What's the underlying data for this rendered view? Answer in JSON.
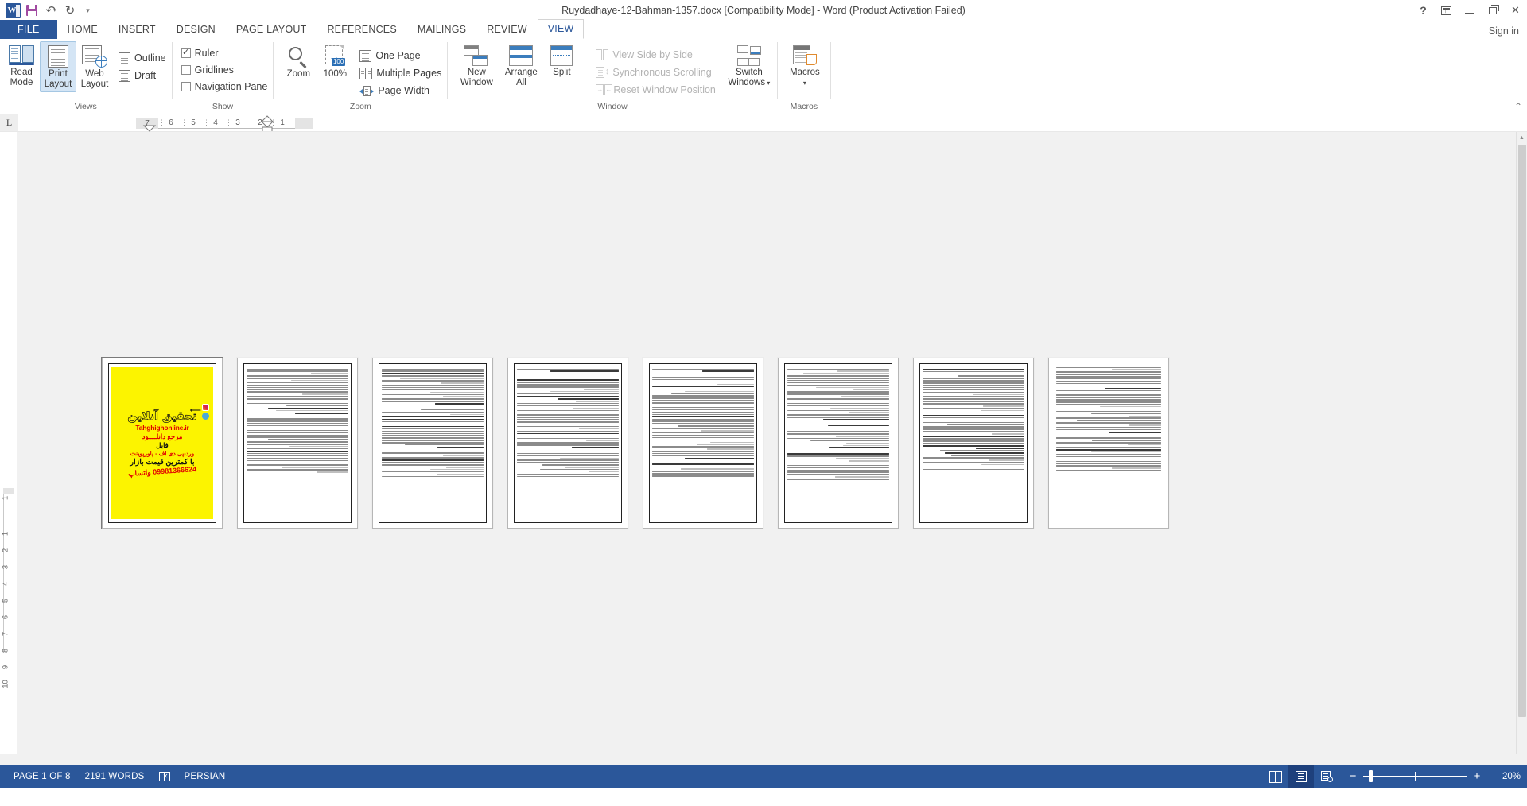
{
  "titlebar": {
    "document_title": "Ruydadhaye-12-Bahman-1357.docx [Compatibility Mode] - Word (Product Activation Failed)",
    "quick_access": [
      {
        "name": "word-logo",
        "label": "W"
      },
      {
        "name": "save-icon",
        "label": "Save"
      },
      {
        "name": "undo-icon",
        "label": "Undo"
      },
      {
        "name": "redo-icon",
        "label": "Redo"
      },
      {
        "name": "customize-qat-icon",
        "label": "Customize Quick Access Toolbar"
      }
    ],
    "window_controls": [
      {
        "name": "help",
        "label": "?"
      },
      {
        "name": "ribbon-display-options",
        "label": "Ribbon Display Options"
      },
      {
        "name": "minimize",
        "label": "Minimize"
      },
      {
        "name": "restore",
        "label": "Restore Down"
      },
      {
        "name": "close",
        "label": "✕"
      }
    ],
    "sign_in": "Sign in"
  },
  "tabs": [
    {
      "label": "FILE",
      "active": false,
      "file": true
    },
    {
      "label": "HOME",
      "active": false
    },
    {
      "label": "INSERT",
      "active": false
    },
    {
      "label": "DESIGN",
      "active": false
    },
    {
      "label": "PAGE LAYOUT",
      "active": false
    },
    {
      "label": "REFERENCES",
      "active": false
    },
    {
      "label": "MAILINGS",
      "active": false
    },
    {
      "label": "REVIEW",
      "active": false
    },
    {
      "label": "VIEW",
      "active": true
    }
  ],
  "ribbon": {
    "groups": [
      {
        "name": "views",
        "label": "Views",
        "buttons": [
          {
            "name": "read-mode",
            "line1": "Read",
            "line2": "Mode",
            "selected": false
          },
          {
            "name": "print-layout",
            "line1": "Print",
            "line2": "Layout",
            "selected": true
          },
          {
            "name": "web-layout",
            "line1": "Web",
            "line2": "Layout",
            "selected": false
          }
        ],
        "small_items": [
          {
            "name": "outline",
            "label": "Outline"
          },
          {
            "name": "draft",
            "label": "Draft"
          }
        ]
      },
      {
        "name": "show",
        "label": "Show",
        "checkboxes": [
          {
            "name": "ruler",
            "label": "Ruler",
            "checked": true
          },
          {
            "name": "gridlines",
            "label": "Gridlines",
            "checked": false
          },
          {
            "name": "navigation-pane",
            "label": "Navigation Pane",
            "checked": false
          }
        ]
      },
      {
        "name": "zoom",
        "label": "Zoom",
        "buttons": [
          {
            "name": "zoom",
            "line1": "Zoom",
            "line2": ""
          },
          {
            "name": "zoom-100",
            "line1": "100%",
            "line2": "",
            "badge": "100"
          }
        ],
        "small_items": [
          {
            "name": "one-page",
            "label": "One Page"
          },
          {
            "name": "multiple-pages",
            "label": "Multiple Pages"
          },
          {
            "name": "page-width",
            "label": "Page Width"
          }
        ]
      },
      {
        "name": "window",
        "label": "Window",
        "buttons": [
          {
            "name": "new-window",
            "line1": "New",
            "line2": "Window"
          },
          {
            "name": "arrange-all",
            "line1": "Arrange",
            "line2": "All"
          },
          {
            "name": "split",
            "line1": "Split",
            "line2": ""
          },
          {
            "name": "switch-windows",
            "line1": "Switch",
            "line2": "Windows",
            "dropdown": true
          }
        ],
        "small_items": [
          {
            "name": "view-side-by-side",
            "label": "View Side by Side",
            "disabled": true
          },
          {
            "name": "synchronous-scrolling",
            "label": "Synchronous Scrolling",
            "disabled": true
          },
          {
            "name": "reset-window-position",
            "label": "Reset Window Position",
            "disabled": true
          }
        ]
      },
      {
        "name": "macros",
        "label": "Macros",
        "buttons": [
          {
            "name": "macros",
            "line1": "Macros",
            "line2": "",
            "dropdown": true
          }
        ]
      }
    ],
    "collapse_label": "⌃"
  },
  "ruler": {
    "tab_stop_marker": "L",
    "horizontal_ticks": [
      "7",
      "6",
      "5",
      "4",
      "3",
      "2",
      "1"
    ],
    "vertical_ticks": [
      "1",
      "1",
      "2",
      "3",
      "4",
      "5",
      "6",
      "7",
      "8",
      "9",
      "10"
    ]
  },
  "document": {
    "page_count_shown": 8,
    "ad_block": {
      "heading": "تحقیق آنلاین",
      "site": "Tahghighonline.ir",
      "line_marja": "مرجع دانلــــود",
      "line_file": "فایل",
      "line_formats": "ورد-پی دی اف - پاورپوینت",
      "line_price": "با کمترین قیمت بازار",
      "line_whatsapp": "09981366624 واتساپ",
      "icons": [
        "instagram-icon",
        "telegram-icon"
      ],
      "background": "#fcf400"
    },
    "pages": [
      {
        "index": 1,
        "type": "ad",
        "selected": true
      },
      {
        "index": 2,
        "type": "text"
      },
      {
        "index": 3,
        "type": "text"
      },
      {
        "index": 4,
        "type": "text"
      },
      {
        "index": 5,
        "type": "text"
      },
      {
        "index": 6,
        "type": "text"
      },
      {
        "index": 7,
        "type": "text"
      },
      {
        "index": 8,
        "type": "text"
      }
    ]
  },
  "statusbar": {
    "page_indicator": "PAGE 1 OF 8",
    "word_count": "2191 WORDS",
    "proofing_icon": "proofing-errors-icon",
    "language": "PERSIAN",
    "view_buttons": [
      {
        "name": "read-mode-view",
        "active": false
      },
      {
        "name": "print-layout-view",
        "active": true
      },
      {
        "name": "web-layout-view",
        "active": false
      }
    ],
    "zoom_out": "−",
    "zoom_in": "+",
    "zoom_level": "20%"
  },
  "colors": {
    "accent": "#2b579a",
    "ribbon_bg": "#ffffff",
    "doc_bg": "#f1f1f1",
    "highlight": "#fcf400",
    "ad_red": "#e00000"
  }
}
